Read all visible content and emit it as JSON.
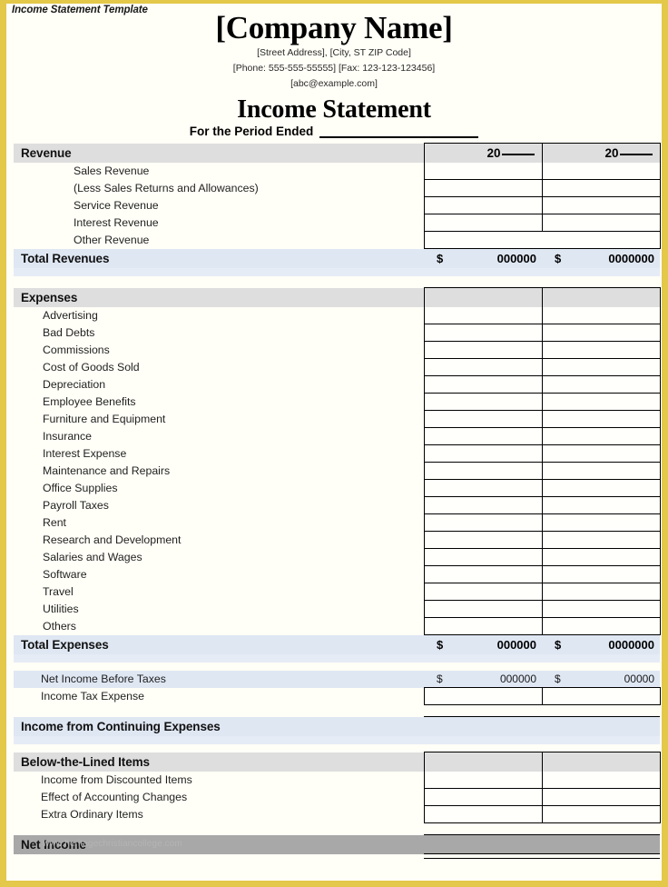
{
  "template_caption": "Income Statement Template",
  "header": {
    "company_name": "[Company Name]",
    "address": "[Street Address], [City, ST ZIP Code]",
    "phone_fax": "[Phone: 555-555-55555] [Fax: 123-123-123456]",
    "email": "[abc@example.com]",
    "doc_title": "Income Statement",
    "period_label": "For the Period Ended"
  },
  "columns": {
    "year1": "20",
    "year2": "20",
    "currency": "$"
  },
  "sections": {
    "revenue": {
      "title": "Revenue",
      "items": [
        "Sales Revenue",
        "(Less Sales Returns and Allowances)",
        "Service Revenue",
        "Interest Revenue",
        "Other Revenue"
      ],
      "total_label": "Total Revenues",
      "total_v1": "000000",
      "total_v2": "0000000"
    },
    "expenses": {
      "title": "Expenses",
      "items": [
        "Advertising",
        "Bad Debts",
        "Commissions",
        "Cost of Goods Sold",
        "Depreciation",
        "Employee Benefits",
        "Furniture and Equipment",
        "Insurance",
        "Interest Expense",
        "Maintenance and Repairs",
        "Office Supplies",
        "Payroll Taxes",
        "Rent",
        "Research and Development",
        "Salaries and Wages",
        "Software",
        "Travel",
        "Utilities",
        "Others"
      ],
      "total_label": "Total Expenses",
      "total_v1": "000000",
      "total_v2": "0000000"
    },
    "pretax": {
      "net_before_taxes_label": "Net Income Before Taxes",
      "net_before_taxes_v1": "000000",
      "net_before_taxes_v2": "00000",
      "income_tax_label": "Income Tax Expense"
    },
    "continuing": {
      "title": "Income from Continuing Expenses"
    },
    "below_the_line": {
      "title": "Below-the-Lined Items",
      "items": [
        "Income from Discounted Items",
        "Effect of Accounting Changes",
        "Extra Ordinary Items"
      ]
    },
    "net_income": {
      "title": "Net Income"
    }
  },
  "watermark": "www.heritagechristiancollege.com",
  "colors": {
    "page_border": "#e3c84a",
    "section_gray": "#dedede",
    "total_blue": "#dfe7f3",
    "net_income_gray": "#a8a8a8"
  }
}
